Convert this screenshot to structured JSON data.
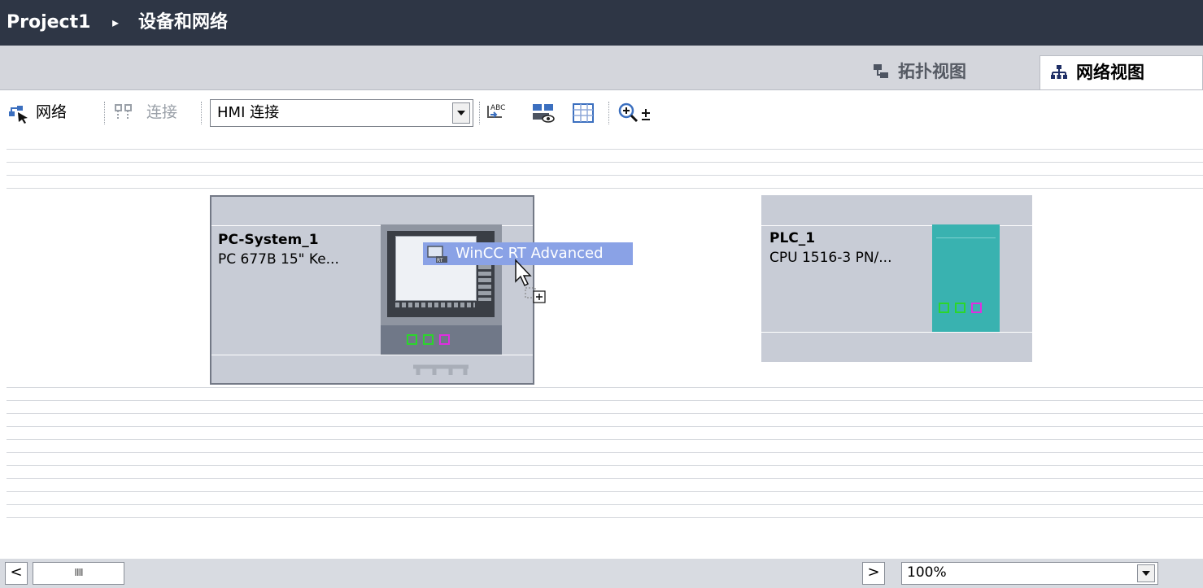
{
  "breadcrumb": {
    "project": "Project1",
    "separator": "▸",
    "page": "设备和网络"
  },
  "tabs": [
    {
      "label": "拓扑视图",
      "icon": "topology-view-icon",
      "active": false
    },
    {
      "label": "网络视图",
      "icon": "network-view-icon",
      "active": true
    }
  ],
  "toolbar": {
    "network_label": "网络",
    "connection_label": "连接",
    "connection_type": "HMI 连接",
    "icons": [
      "network-mode-icon",
      "connection-mode-icon",
      "address-label-icon",
      "show-hide-icon",
      "table-view-icon",
      "zoom-icon"
    ]
  },
  "devices": [
    {
      "name": "PC-System_1",
      "type": "PC 677B 15\" Ke...",
      "ports": [
        "#2bd62b",
        "#2bd62b",
        "#e02ee0"
      ]
    },
    {
      "name": "PLC_1",
      "type": "CPU 1516-3 PN/...",
      "ports": [
        "#2bd62b",
        "#2bd62b",
        "#e02ee0"
      ]
    }
  ],
  "drag_item": {
    "label": "WinCC RT Advanced",
    "icon": "wincc-rt-icon"
  },
  "statusbar": {
    "zoom": "100%",
    "scroll_left": "<",
    "scroll_thumb": "IIII",
    "scroll_right": ">"
  },
  "colors": {
    "titlebar": "#2e3645",
    "canvas_device": "#c8ccd6",
    "plc": "#39b2b0",
    "selection": "#8aa2e6"
  }
}
